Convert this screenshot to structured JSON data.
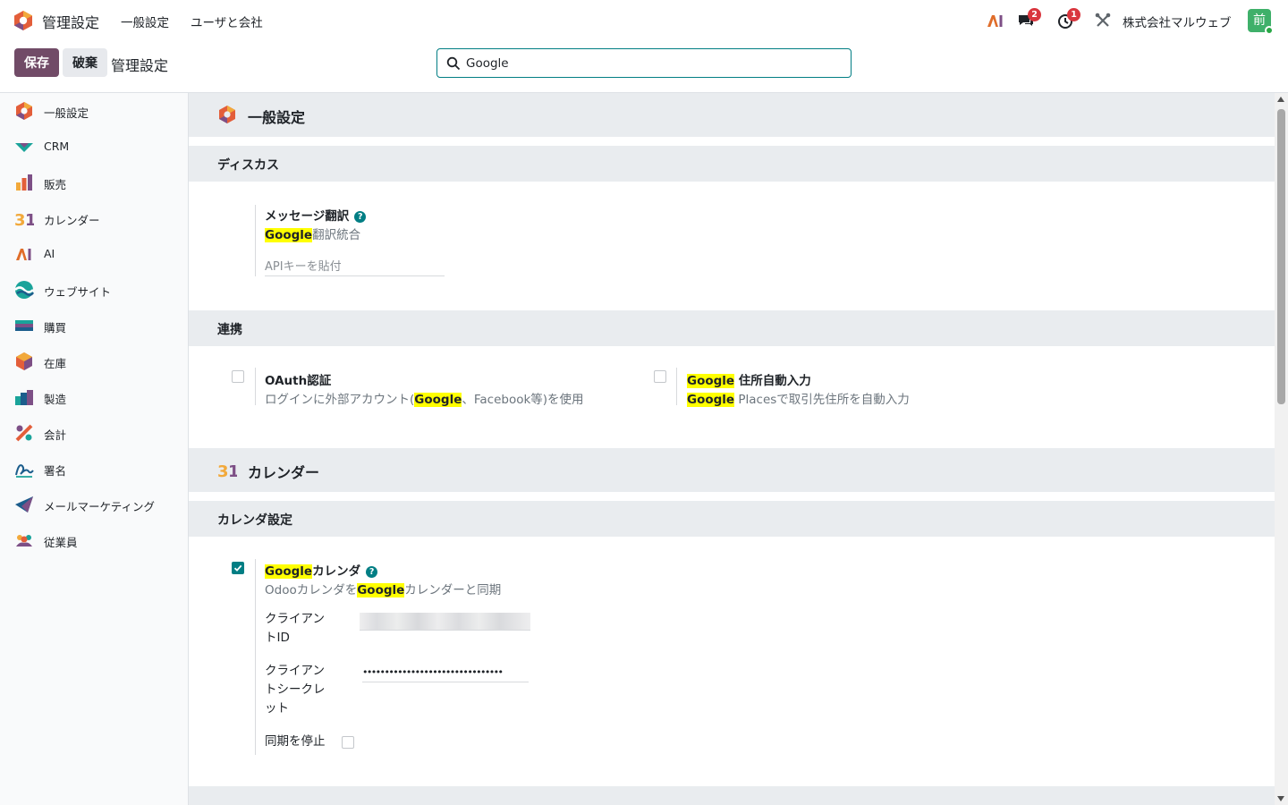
{
  "topbar": {
    "app_title": "管理設定",
    "menu": [
      "一般設定",
      "ユーザと会社"
    ],
    "company": "株式会社マルウェブ",
    "avatar_initial": "前",
    "messages_badge": "2",
    "activities_badge": "1",
    "icons": [
      "odoo-logo",
      "ai-icon",
      "chat-icon",
      "activity-clock-icon",
      "debug-tools-icon"
    ]
  },
  "control_panel": {
    "save_label": "保存",
    "discard_label": "破棄",
    "breadcrumb": "管理設定",
    "search_value": "Google"
  },
  "sidebar": {
    "items": [
      {
        "label": "一般設定",
        "icon": "settings-app-icon"
      },
      {
        "label": "CRM",
        "icon": "crm-icon"
      },
      {
        "label": "販売",
        "icon": "sales-icon"
      },
      {
        "label": "カレンダー",
        "icon": "calendar-31-icon"
      },
      {
        "label": "AI",
        "icon": "ai-icon"
      },
      {
        "label": "ウェブサイト",
        "icon": "website-icon"
      },
      {
        "label": "購買",
        "icon": "purchase-icon"
      },
      {
        "label": "在庫",
        "icon": "inventory-icon"
      },
      {
        "label": "製造",
        "icon": "manufacturing-icon"
      },
      {
        "label": "会計",
        "icon": "accounting-icon"
      },
      {
        "label": "署名",
        "icon": "sign-icon"
      },
      {
        "label": "メールマーケティング",
        "icon": "email-marketing-icon"
      },
      {
        "label": "従業員",
        "icon": "employees-icon"
      }
    ]
  },
  "main": {
    "general_header": "一般設定",
    "discuss": {
      "header": "ディスカス",
      "translate_title": "メッセージ翻訳",
      "translate_desc_hl": "Google",
      "translate_desc_rest": "翻訳統合",
      "api_placeholder": "APIキーを貼付"
    },
    "integrations": {
      "header": "連携",
      "oauth_title": "OAuth認証",
      "oauth_desc_pre": "ログインに外部アカウント(",
      "oauth_desc_hl": "Google",
      "oauth_desc_post": "、Facebook等)を使用",
      "oauth_checked": false,
      "places_title_hl": "Google",
      "places_title_rest": " 住所自動入力",
      "places_desc_hl": "Google",
      "places_desc_rest": " Placesで取引先住所を自動入力",
      "places_checked": false
    },
    "calendar_header": "カレンダー",
    "calendar_settings": {
      "header": "カレンダ設定",
      "gcal_title_hl": "Google",
      "gcal_title_rest": "カレンダ",
      "gcal_desc_pre": "Odooカレンダを",
      "gcal_desc_hl": "Google",
      "gcal_desc_post": "カレンダーと同期",
      "gcal_checked": true,
      "client_id_label": "クライアントID",
      "client_secret_label": "クライアントシークレット",
      "client_secret_value": "••••••••••••••••••••••••••••••••",
      "pause_sync_label": "同期を停止",
      "pause_sync_checked": false
    }
  }
}
